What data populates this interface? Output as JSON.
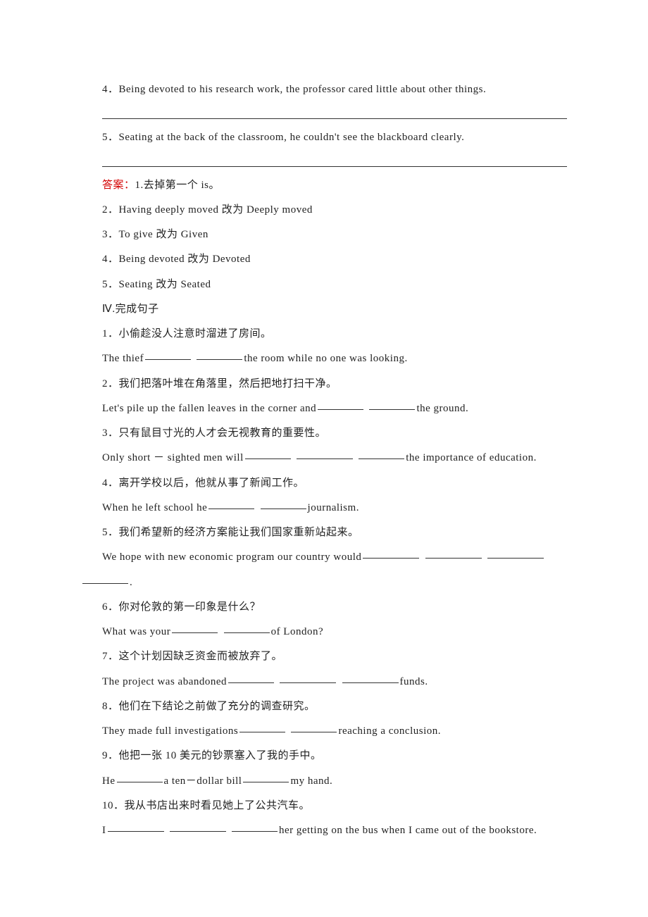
{
  "q4": "4．Being devoted to his research work, the professor cared little about other things.",
  "q5": "5．Seating at the back of the classroom, he couldn't see the blackboard clearly.",
  "answer_label": "答案：",
  "ans1": "1.去掉第一个 is。",
  "ans2": "2．Having deeply moved 改为 Deeply moved",
  "ans3": "3．To give 改为 Given",
  "ans4": "4．Being devoted 改为 Devoted",
  "ans5": "5．Seating 改为 Seated",
  "section4": "Ⅳ.完成句子",
  "s1": {
    "zh": "1．小偷趁没人注意时溜进了房间。",
    "en_a": "The thief",
    "en_b": "the room while no one was looking."
  },
  "s2": {
    "zh": "2．我们把落叶堆在角落里，然后把地打扫干净。",
    "en_a": "Let's pile up the fallen leaves in the corner and",
    "en_b": "the ground."
  },
  "s3": {
    "zh": "3．只有鼠目寸光的人才会无视教育的重要性。",
    "en_a": "Only short － sighted men will",
    "en_b": "the importance of education."
  },
  "s4": {
    "zh": "4．离开学校以后，他就从事了新闻工作。",
    "en_a": "When he left school he",
    "en_b": "journalism."
  },
  "s5": {
    "zh": "5．我们希望新的经济方案能让我们国家重新站起来。",
    "en_a": "We hope with new economic program our country would",
    "en_b": "."
  },
  "s6": {
    "zh": "6．你对伦敦的第一印象是什么？",
    "en_a": "What was your",
    "en_b": "of London?"
  },
  "s7": {
    "zh": "7．这个计划因缺乏资金而被放弃了。",
    "en_a": "The project was abandoned",
    "en_b": "funds."
  },
  "s8": {
    "zh": "8．他们在下结论之前做了充分的调查研究。",
    "en_a": "They made full investigations",
    "en_b": "reaching a conclusion."
  },
  "s9": {
    "zh": "9．他把一张 10 美元的钞票塞入了我的手中。",
    "en_a": "He",
    "en_b": "a ten－dollar bill",
    "en_c": "my hand."
  },
  "s10": {
    "zh": "10．我从书店出来时看见她上了公共汽车。",
    "en_a": "I",
    "en_b": "her getting on the bus when I came out of the bookstore."
  }
}
